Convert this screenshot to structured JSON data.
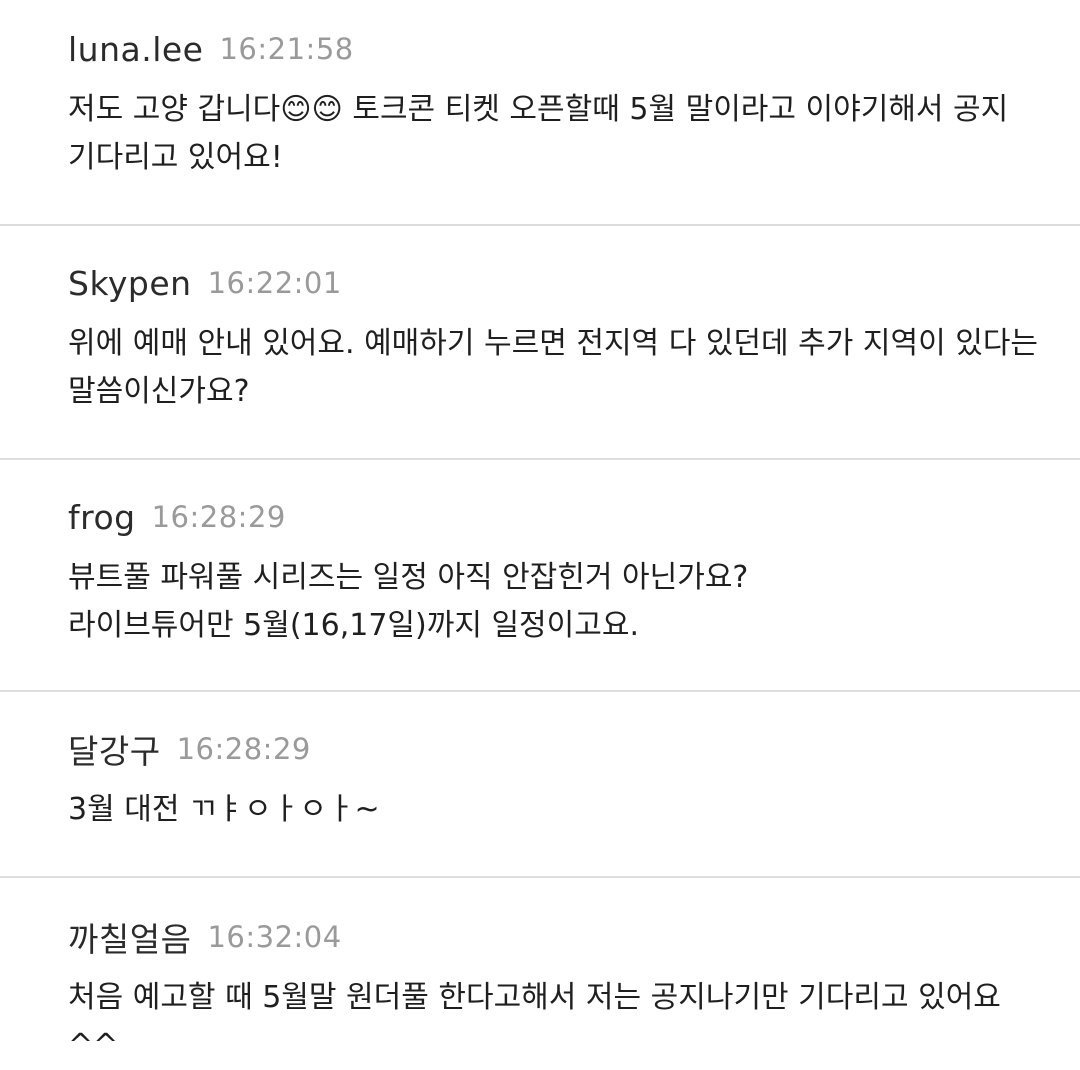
{
  "comments": [
    {
      "author": "luna.lee",
      "time": "16:21:58",
      "text": "저도 고양 갑니다😊😊 토크콘 티켓 오픈할때 5월 말이라고 이야기해서 공지 기다리고 있어요!"
    },
    {
      "author": "Skypen",
      "time": "16:22:01",
      "text": "위에 예매 안내 있어요. 예매하기 누르면 전지역 다 있던데 추가 지역이 있다는 말씀이신가요?"
    },
    {
      "author": "frog",
      "time": "16:28:29",
      "text": "뷰트풀 파워풀 시리즈는 일정 아직 안잡힌거 아닌가요?\n라이브튜어만 5월(16,17일)까지 일정이고요."
    },
    {
      "author": "달강구",
      "time": "16:28:29",
      "text": "3월 대전 ㄲㅑㅇㅏㅇㅏ~"
    },
    {
      "author": "까칠얼음",
      "time": "16:32:04",
      "text": "처음 예고할 때 5월말 원더풀 한다고해서 저는 공지나기만 기다리고 있어요^^"
    }
  ]
}
